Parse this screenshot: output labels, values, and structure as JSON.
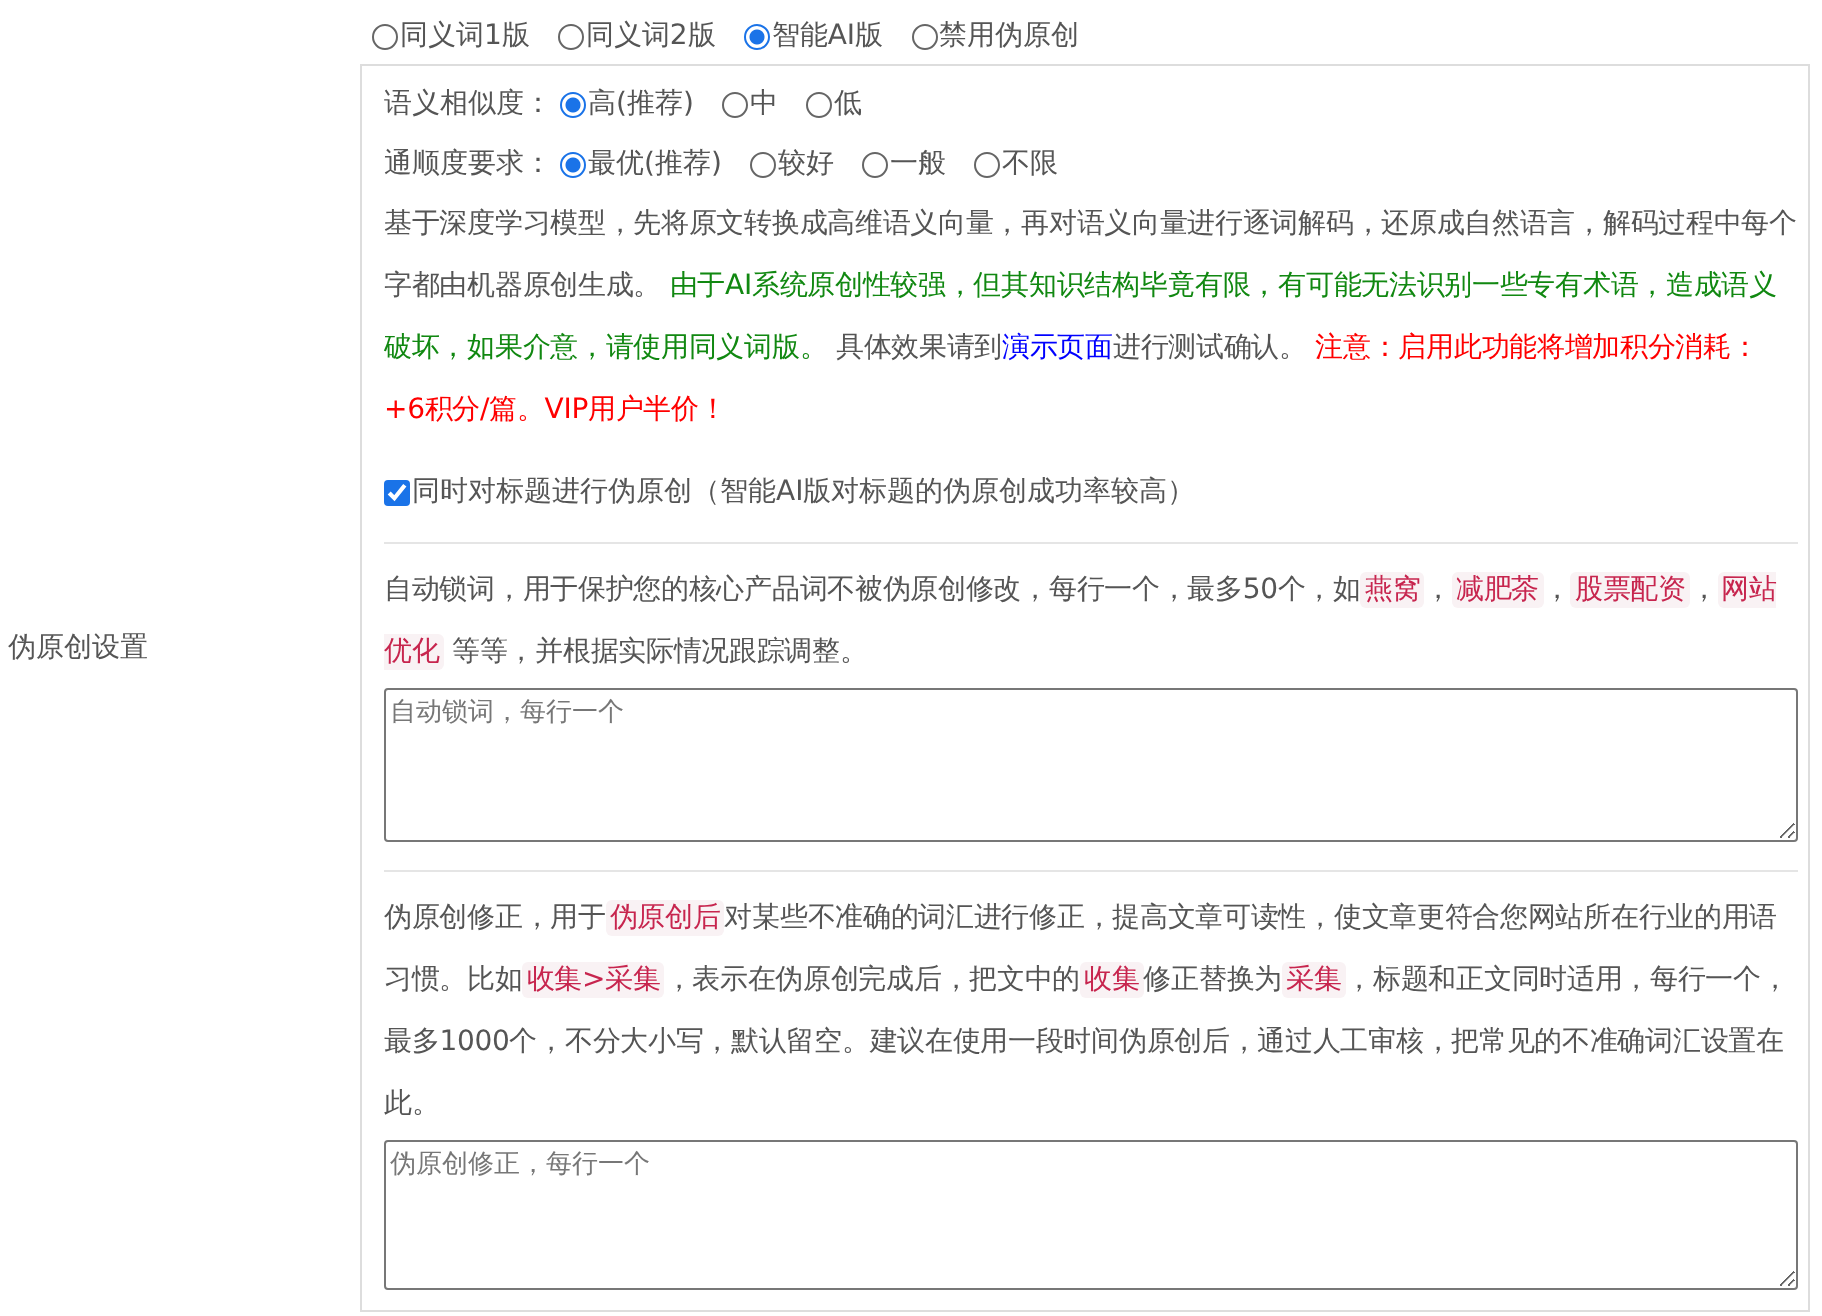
{
  "section_label": "伪原创设置",
  "mode_options": [
    {
      "label": "同义词1版",
      "selected": false
    },
    {
      "label": "同义词2版",
      "selected": false
    },
    {
      "label": "智能AI版",
      "selected": true
    },
    {
      "label": "禁用伪原创",
      "selected": false
    }
  ],
  "similarity": {
    "label": "语义相似度：",
    "options": [
      {
        "label": "高(推荐)",
        "selected": true
      },
      {
        "label": "中",
        "selected": false
      },
      {
        "label": "低",
        "selected": false
      }
    ]
  },
  "fluency": {
    "label": "通顺度要求：",
    "options": [
      {
        "label": "最优(推荐)",
        "selected": true
      },
      {
        "label": "较好",
        "selected": false
      },
      {
        "label": "一般",
        "selected": false
      },
      {
        "label": "不限",
        "selected": false
      }
    ]
  },
  "ai_description": [
    {
      "kind": "plain",
      "text": "基于深度学习模型，先将原文转换成高维语义向量，再对语义向量进行逐词解码，还原成自然语言，解码过程中每个字都由机器原创生成。 "
    },
    {
      "kind": "warning",
      "text": "由于AI系统原创性较强，但其知识结构毕竟有限，有可能无法识别一些专有术语，造成语义破坏，如果介意，请使用同义词版。"
    },
    {
      "kind": "plain",
      "text": " 具体效果请到"
    },
    {
      "kind": "link",
      "text": "演示页面"
    },
    {
      "kind": "plain",
      "text": "进行测试确认。 "
    },
    {
      "kind": "notice",
      "text": "注意：启用此功能将增加积分消耗：+6积分/篇。VIP用户半价！"
    }
  ],
  "title_option": {
    "label": "同时对标题进行伪原创（智能AI版对标题的伪原创成功率较高）",
    "checked": true
  },
  "lock_words": {
    "description": [
      {
        "kind": "plain",
        "text": "自动锁词，用于保护您的核心产品词不被伪原创修改，每行一个，最多50个，如"
      },
      {
        "kind": "code",
        "text": "燕窝"
      },
      {
        "kind": "plain",
        "text": "，"
      },
      {
        "kind": "code",
        "text": "减肥茶"
      },
      {
        "kind": "plain",
        "text": "，"
      },
      {
        "kind": "code",
        "text": "股票配资"
      },
      {
        "kind": "plain",
        "text": "，"
      },
      {
        "kind": "code",
        "text": "网站优化"
      },
      {
        "kind": "plain",
        "text": " 等等，并根据实际情况跟踪调整。"
      }
    ],
    "placeholder": "自动锁词，每行一个"
  },
  "correction": {
    "description": [
      {
        "kind": "plain",
        "text": "伪原创修正，用于"
      },
      {
        "kind": "code",
        "text": "伪原创后"
      },
      {
        "kind": "plain",
        "text": "对某些不准确的词汇进行修正，提高文章可读性，使文章更符合您网站所在行业的用语习惯。比如"
      },
      {
        "kind": "code",
        "text": "收集>采集"
      },
      {
        "kind": "plain",
        "text": "，表示在伪原创完成后，把文中的"
      },
      {
        "kind": "code",
        "text": "收集"
      },
      {
        "kind": "plain",
        "text": "修正替换为"
      },
      {
        "kind": "code",
        "text": "采集"
      },
      {
        "kind": "plain",
        "text": "，标题和正文同时适用，每行一个，最多1000个，不分大小写，默认留空。建议在使用一段时间伪原创后，通过人工审核，把常见的不准确词汇设置在此。"
      }
    ],
    "placeholder": "伪原创修正，每行一个"
  }
}
